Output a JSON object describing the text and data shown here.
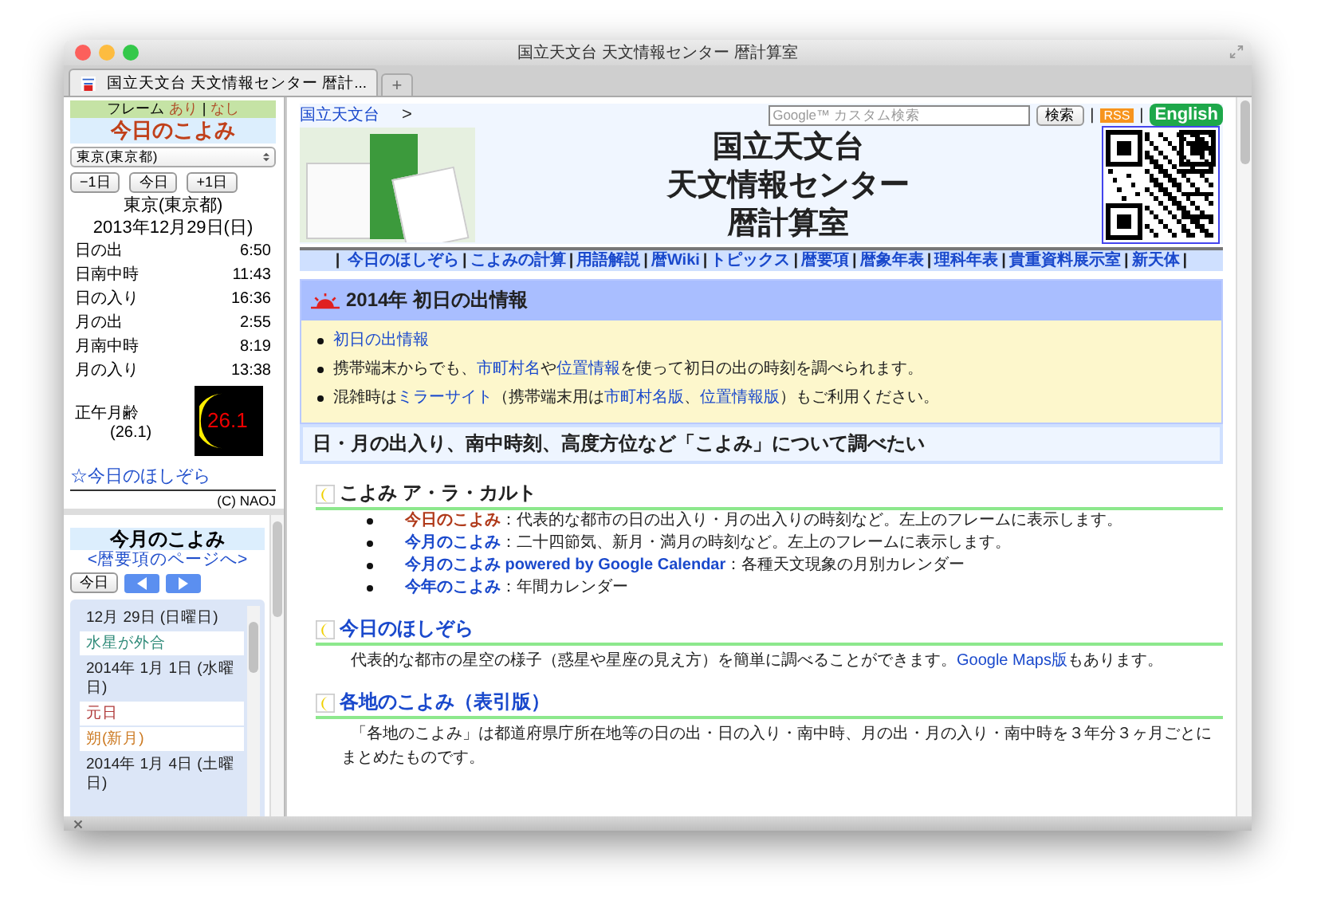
{
  "window": {
    "title": "国立天文台 天文情報センター 暦計算室"
  },
  "tabs": [
    {
      "label": "国立天文台 天文情報センター 暦計...",
      "selected": true
    }
  ],
  "new_tab_button": "+",
  "today_frame": {
    "frame_label": "フレーム",
    "frame_options": [
      "あり",
      "なし"
    ],
    "frame_separator": "|",
    "title": "今日のこよみ",
    "location_select": "東京(東京都)",
    "buttons": [
      "−1日",
      "今日",
      "+1日"
    ],
    "location": "東京(東京都)",
    "date": "2013年12月29日(日)",
    "times": [
      {
        "label": "日の出",
        "value": "6:50"
      },
      {
        "label": "日南中時",
        "value": "11:43"
      },
      {
        "label": "日の入り",
        "value": "16:36"
      },
      {
        "label": "月の出",
        "value": "2:55"
      },
      {
        "label": "月南中時",
        "value": "8:19"
      },
      {
        "label": "月の入り",
        "value": "13:38"
      }
    ],
    "moon_age_label": "正午月齢",
    "moon_age": "(26.1)",
    "moon_image_value": "26.1",
    "stars_link": "☆今日のほしぞら",
    "copyright": "(C) NAOJ"
  },
  "month_frame": {
    "title": "今月のこよみ",
    "link": "<暦要項のページへ>",
    "today_button": "今日",
    "entries": [
      {
        "kind": "date",
        "text": "12月 29日 (日曜日)"
      },
      {
        "kind": "event",
        "text": "水星が外合",
        "color": "#2e8a78"
      },
      {
        "kind": "date",
        "text": "2014年 1月 1日 (水曜日)"
      },
      {
        "kind": "event",
        "text": "元日",
        "color": "#b03a3a"
      },
      {
        "kind": "event",
        "text": "朔(新月)",
        "color": "#cc7a22"
      },
      {
        "kind": "date",
        "text": "2014年 1月 4日 (土曜日)"
      }
    ]
  },
  "header": {
    "breadcrumb": "国立天文台",
    "breadcrumb_arrow": ">",
    "search_placeholder": "Google™ カスタム検索",
    "search_button": "検索",
    "separator": "|",
    "rss": "RSS",
    "english": "English",
    "title_lines": [
      "国立天文台",
      "天文情報センター",
      "暦計算室"
    ]
  },
  "nav": {
    "separator": "|",
    "items": [
      "今日のほしぞら",
      "こよみの計算",
      "用語解説",
      "暦Wiki",
      "トピックス",
      "暦要項",
      "暦象年表",
      "理科年表",
      "貴重資料展示室",
      "新天体"
    ]
  },
  "notice": {
    "title": "2014年 初日の出情報",
    "items": [
      [
        {
          "text": "初日の出情報",
          "link": true
        }
      ],
      [
        {
          "text": "携帯端末からでも、",
          "link": false
        },
        {
          "text": "市町村名",
          "link": true
        },
        {
          "text": "や",
          "link": false
        },
        {
          "text": "位置情報",
          "link": true
        },
        {
          "text": "を使って初日の出の時刻を調べられます。",
          "link": false
        }
      ],
      [
        {
          "text": "混雑時は",
          "link": false
        },
        {
          "text": "ミラーサイト",
          "link": true
        },
        {
          "text": "（携帯端末用は",
          "link": false
        },
        {
          "text": "市町村名版",
          "link": true
        },
        {
          "text": "、",
          "link": false
        },
        {
          "text": "位置情報版",
          "link": true
        },
        {
          "text": "）もご利用ください。",
          "link": false
        }
      ]
    ]
  },
  "section_heading": "日・月の出入り、南中時刻、高度方位など「こよみ」について調べたい",
  "sections": [
    {
      "title": "こよみ ア・ラ・カルト",
      "title_link": false,
      "items": [
        {
          "link": "今日のこよみ",
          "current": true,
          "text": "：代表的な都市の日の出入り・月の出入りの時刻など。左上のフレームに表示します。"
        },
        {
          "link": "今月のこよみ",
          "current": false,
          "text": "：二十四節気、新月・満月の時刻など。左上のフレームに表示します。"
        },
        {
          "link": "今月のこよみ powered by Google Calendar",
          "current": false,
          "text": "：各種天文現象の月別カレンダー"
        },
        {
          "link": "今年のこよみ",
          "current": false,
          "text": "：年間カレンダー"
        }
      ]
    },
    {
      "title": "今日のほしぞら",
      "title_link": true,
      "description": [
        {
          "text": "代表的な都市の星空の様子（惑星や星座の見え方）を簡単に調べることができます。",
          "link": false
        },
        {
          "text": "Google Maps版",
          "link": true
        },
        {
          "text": "もあります。",
          "link": false
        }
      ]
    },
    {
      "title": "各地のこよみ（表引版）",
      "title_link": true,
      "description": [
        {
          "text": "「各地のこよみ」は都道府県庁所在地等の日の出・日の入り・南中時、月の出・月の入り・南中時を３年分３ヶ月ごとにまとめたものです。",
          "link": false
        }
      ]
    }
  ]
}
